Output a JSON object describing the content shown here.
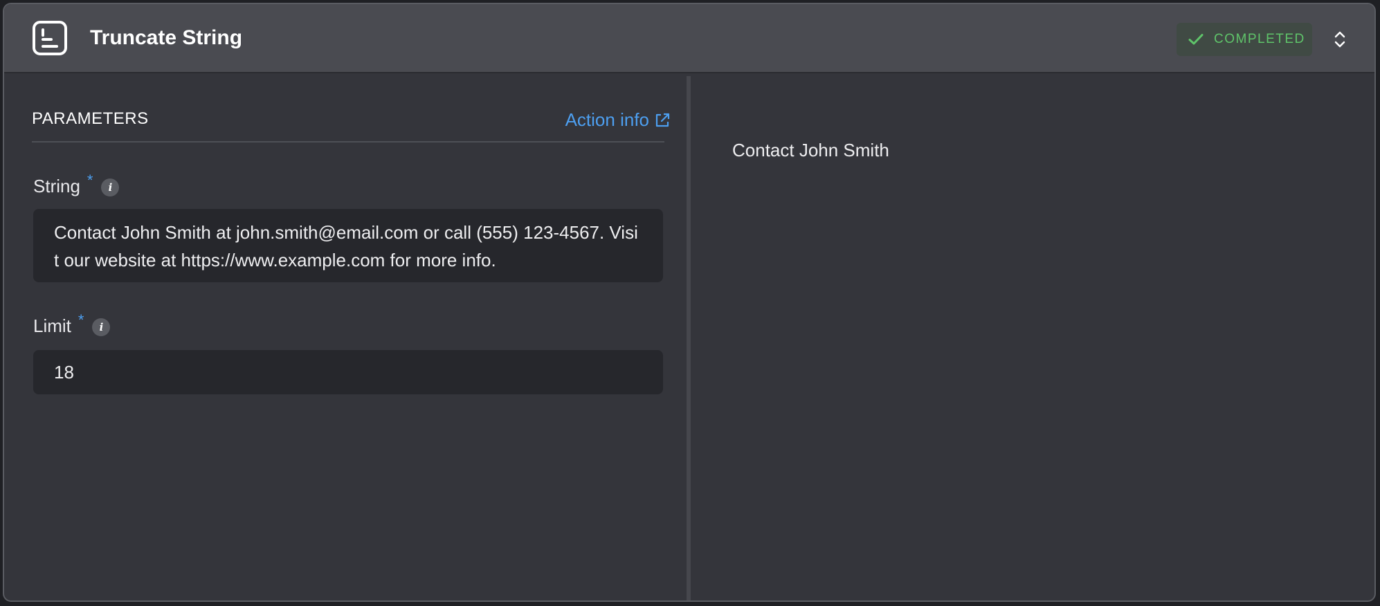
{
  "header": {
    "title": "Truncate String",
    "status": "COMPLETED",
    "app_icon": "text-document-icon",
    "expand_icon": "chevron-up-down-icon"
  },
  "parameters": {
    "title": "PARAMETERS",
    "action_info_label": "Action info",
    "fields": [
      {
        "label": "String",
        "required_marker": "*",
        "info_glyph": "i",
        "value": "Contact John Smith at john.smith@email.com or call (555) 123-4567. Visit our website at https://www.example.com for more info."
      },
      {
        "label": "Limit",
        "required_marker": "*",
        "info_glyph": "i",
        "value": "18"
      }
    ]
  },
  "result": {
    "output": "Contact John Smith"
  },
  "colors": {
    "accent": "#4d9ff0",
    "success": "#5fc46a",
    "panel": "#34353b",
    "header": "#4a4b51"
  }
}
